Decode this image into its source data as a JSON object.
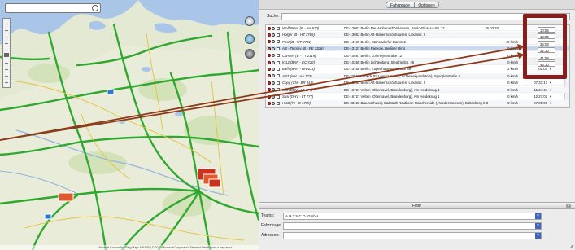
{
  "tabs": [
    {
      "label": "Fahrzeuge",
      "active": true
    },
    {
      "label": "Optionen",
      "active": false
    }
  ],
  "search": {
    "label": "Suche:",
    "value": ""
  },
  "vehicles": [
    {
      "status": "red",
      "name": "Wolf-Peter  (B - AH 610)",
      "address": "DE-13057 Berlin Neu-Hohenschönhausen, Pablo-Picasso-Str. 31",
      "date": "26.03.20",
      "speed": "",
      "time": "10:55"
    },
    {
      "status": "red",
      "name": "Holger  (B - HZ 7765)",
      "address": "DE-13053 Berlin Alt-Hohenschönhausen, Lukasstr. 5",
      "date": "",
      "speed": "",
      "time": "13:00"
    },
    {
      "status": "red",
      "name": "Post  (B - MT 4761)",
      "address": "DE-14169 Berlin, Stahnsdorfer Damm 2",
      "date": "",
      "speed": "49 km/h",
      "time": "25:03"
    },
    {
      "status": "green",
      "name": "AB - Tommy  (B - PE 3326)",
      "address": "DE-13127 Berlin Pankow, Berliner Ring",
      "date": "",
      "speed": "0 km/h",
      "time": "32:30"
    },
    {
      "status": "red",
      "name": "Carsten  (B - TT 2119)",
      "address": "DE-10587 Berlin, Lohmeyerstraße 12",
      "date": "",
      "speed": "0 km/h",
      "time": "41:58"
    },
    {
      "status": "red",
      "name": "K 12  (BAR - EC 720)",
      "address": "DE-10365 Berlin Lichtenberg, Siegfriedstr. 46",
      "date": "",
      "speed": "0 km/h",
      "time": "46:10"
    },
    {
      "status": "red",
      "name": "Bafft  (BAR - DN 671)",
      "address": "DE-13158 Berlin, Kopenhagener Straße 89",
      "date": "",
      "speed": "2 km/h",
      "time": "01:07"
    },
    {
      "status": "green",
      "name": "A 01  (HH - AA 123)",
      "address": "DE-23560 Lübeck St. Lorenz Nord (, Schleswig-Holstein), Sperglerstraße 4",
      "date": "",
      "speed": "0 km/h",
      "time": "01:08"
    },
    {
      "status": "red",
      "name": "Copy  (CN - BR 918)",
      "address": "DE-13053 Berlin Alt-Hohenschönhausen, Lukasstr. 5",
      "date": "",
      "speed": "0 km/h",
      "time": "07:33:17"
    },
    {
      "status": "red",
      "name": "Lori  (DHV - LT 777)",
      "address": "DE-16727 Velten (Oberhavel, Brandenburg), Am Heideknug 1",
      "date": "",
      "speed": "0 km/h",
      "time": "11:24:44"
    },
    {
      "status": "red",
      "name": "Susi  (DHV - LT 777)",
      "address": "DE-16727 Velten (Oberhavel, Brandenburg), Am Heideknug 1",
      "date": "",
      "speed": "0 km/h",
      "time": "12:27:02"
    },
    {
      "status": "red",
      "name": "H 60  (PI - O 6789)",
      "address": "DE-38126 Braunschweig Südstadt-Rautheim-Mascheroide (, Niedersachsen), Boltenberg 6-8",
      "date": "",
      "speed": "0 km/h",
      "time": "07:05:00"
    }
  ],
  "highlight_times": [
    "10:55",
    "13:00",
    "25:03",
    "32:30",
    "41:58",
    "46:10"
  ],
  "filter": {
    "title": "Filter",
    "teams_label": "Teams:",
    "teams_value": "A.R.T.S.C.O. GmbH",
    "vehicles_label": "Fahrzeuge:",
    "vehicles_value": "",
    "addresses_label": "Adressen:",
    "addresses_value": ""
  },
  "map": {
    "footer": "Microsoft Corporation  Bing Maps  NAVTEQ  © 2010 Microsoft Corporation  Terms of Use  Report a map error"
  },
  "colors": {
    "highlight": "#8b1c1c",
    "arrow": "#8b3a1a",
    "road": "#2fa82f"
  }
}
